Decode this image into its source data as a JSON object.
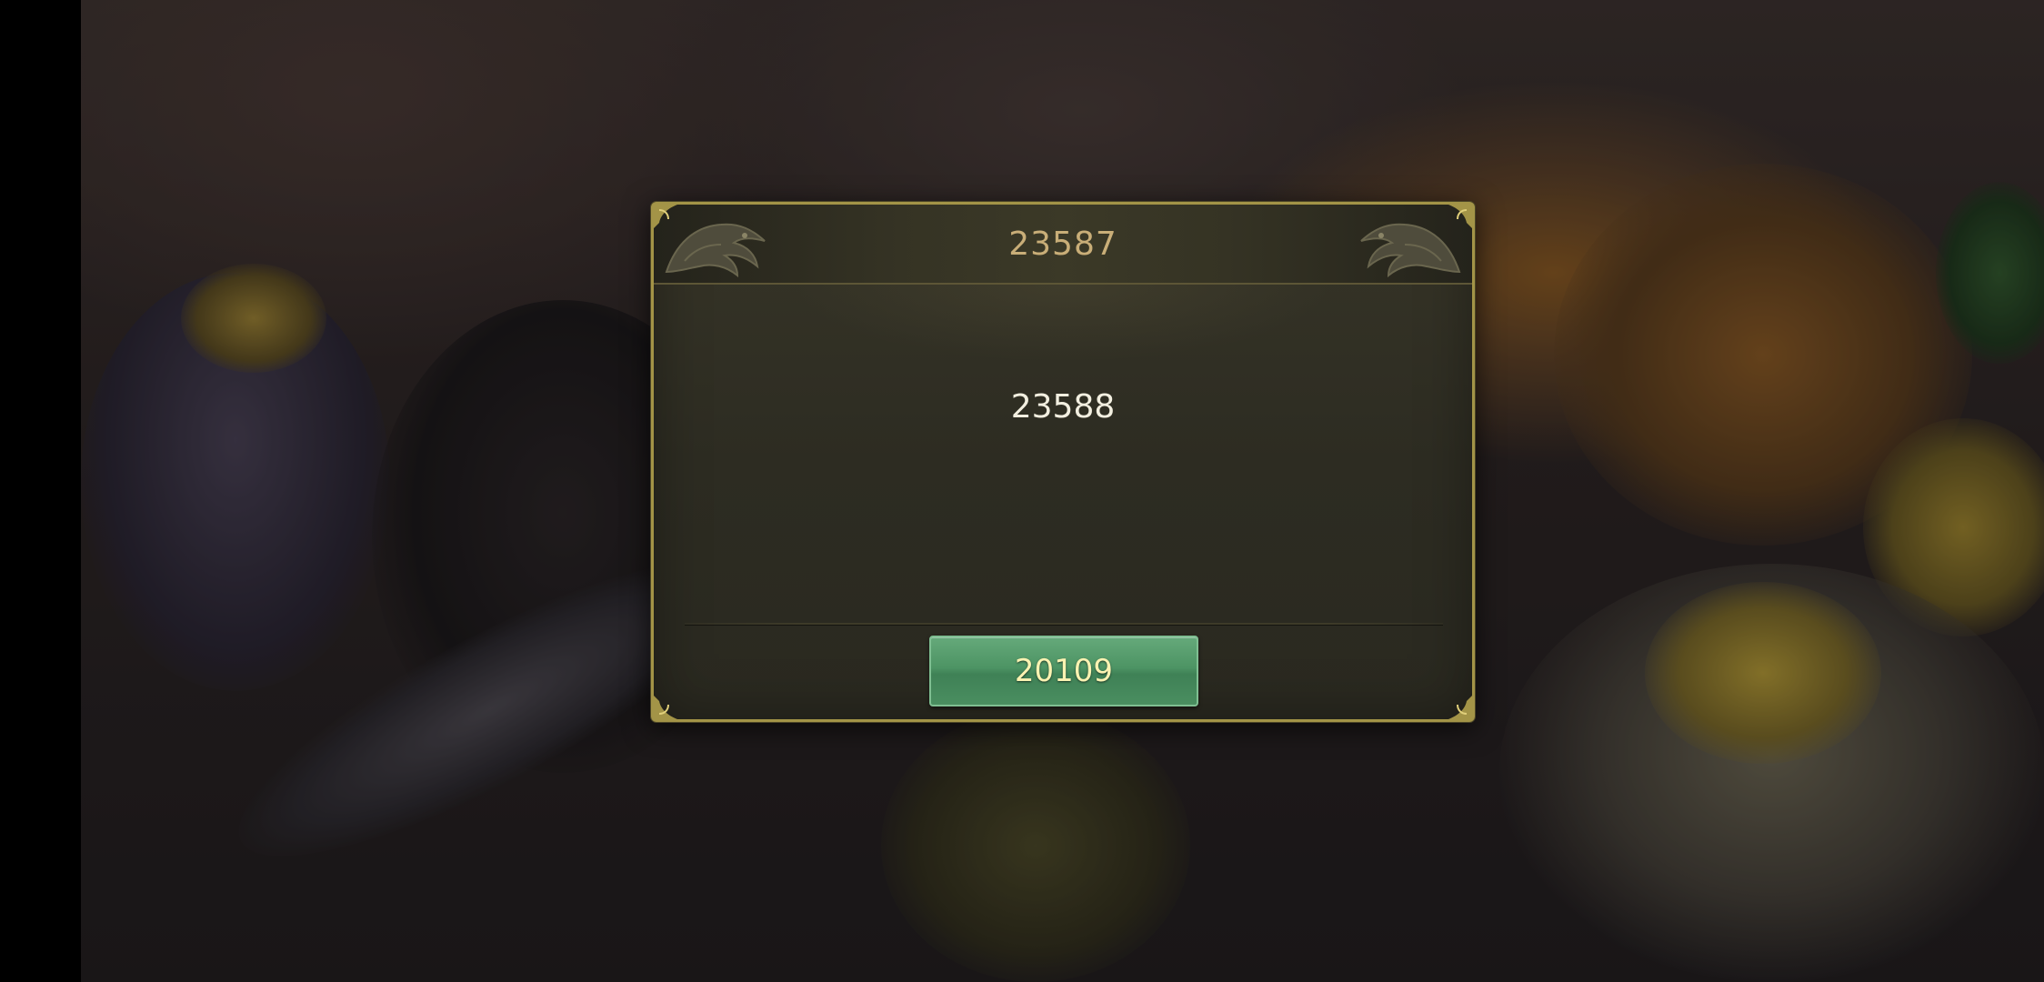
{
  "dialog": {
    "title": "23587",
    "message": "23588",
    "confirm_label": "20109"
  },
  "colors": {
    "frame_gold": "#a39447",
    "title_text": "#c9ae78",
    "message_text": "#f2efe0",
    "button_green": "#4d9464",
    "button_text": "#fbf3b2"
  },
  "icons": [
    "dragon-ornament-icon",
    "corner-ornament-icon"
  ]
}
